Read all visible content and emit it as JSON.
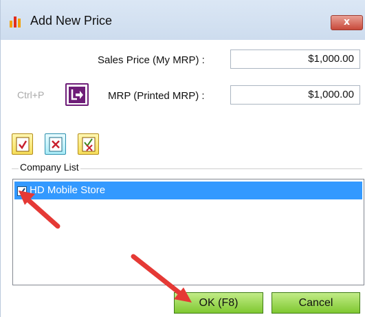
{
  "window": {
    "title": "Add New Price",
    "close_glyph": "x"
  },
  "form": {
    "sales_price_label": "Sales Price (My MRP) :",
    "sales_price_value": "$1,000.00",
    "mrp_label": "MRP (Printed MRP) :",
    "mrp_value": "$1,000.00",
    "shortcut_hint": "Ctrl+P"
  },
  "toolbar": {
    "icons": [
      "check-all-icon",
      "uncheck-all-icon",
      "invert-selection-icon"
    ]
  },
  "company_list": {
    "label": "Company List",
    "items": [
      {
        "name": "HD Mobile Store",
        "checked": true,
        "selected": true
      }
    ]
  },
  "buttons": {
    "ok_label": "OK (F8)",
    "cancel_label": "Cancel"
  },
  "colors": {
    "selection": "#3399ff",
    "button_green": "#7fc830",
    "annotation_arrow": "#e53935",
    "mrp_button_border": "#6e1d78"
  }
}
